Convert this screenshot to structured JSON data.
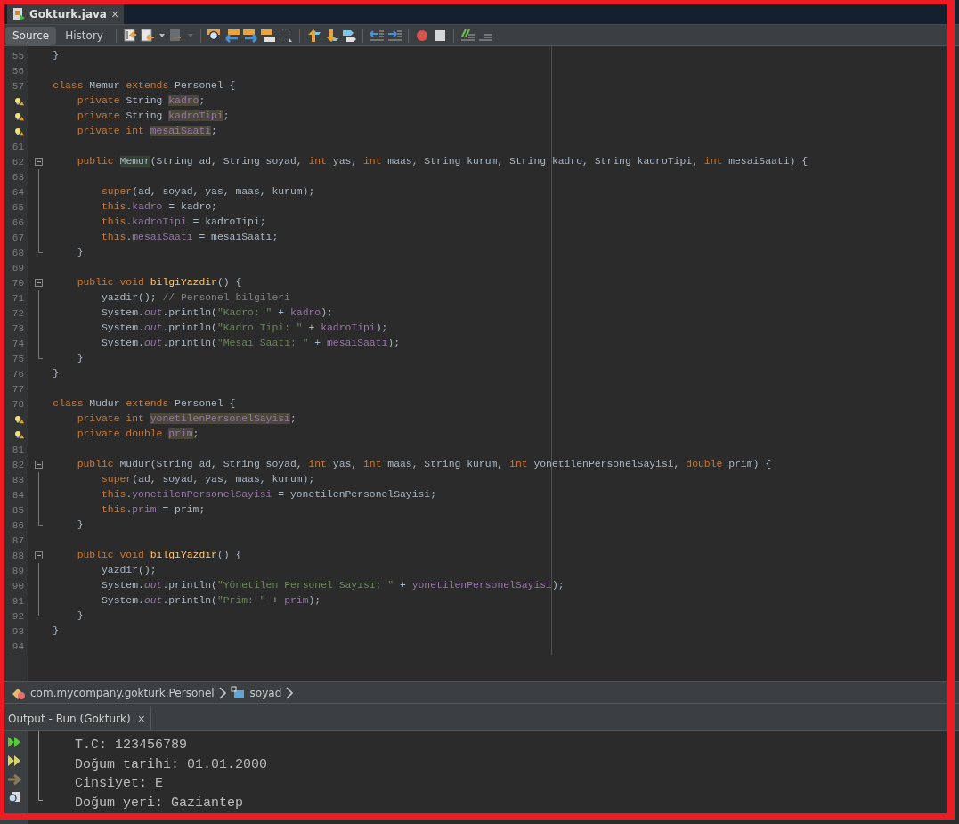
{
  "editor_tab": {
    "title": "Gokturk.java",
    "selected": true,
    "close_label": "×"
  },
  "view_tabs": [
    {
      "label": "Source",
      "selected": true
    },
    {
      "label": "History",
      "selected": false
    }
  ],
  "code": {
    "lines": [
      {
        "number": "55",
        "tokens": [
          {
            "kind": "plain",
            "text": "    }"
          }
        ]
      },
      {
        "number": "56"
      },
      {
        "number": "57",
        "tokens": [
          {
            "kind": "keyword",
            "text": "    class"
          },
          {
            "kind": "plain",
            "text": " Memur "
          },
          {
            "kind": "keyword",
            "text": "extends"
          },
          {
            "kind": "plain",
            "text": " Personel {"
          }
        ]
      },
      {
        "warning": true,
        "tokens": [
          {
            "kind": "keyword",
            "text": "        private"
          },
          {
            "kind": "plain",
            "text": " String "
          },
          {
            "kind": "field",
            "text": "kadro",
            "highlighted": true
          },
          {
            "kind": "plain",
            "text": ";"
          }
        ]
      },
      {
        "warning": true,
        "tokens": [
          {
            "kind": "keyword",
            "text": "        private"
          },
          {
            "kind": "plain",
            "text": " String "
          },
          {
            "kind": "field",
            "text": "kadroTipi",
            "highlighted": true
          },
          {
            "kind": "plain",
            "text": ";"
          }
        ]
      },
      {
        "warning": true,
        "tokens": [
          {
            "kind": "keyword",
            "text": "        private int "
          },
          {
            "kind": "field",
            "text": "mesaiSaati",
            "highlighted": true
          },
          {
            "kind": "plain",
            "text": ";"
          }
        ]
      },
      {
        "number": "61"
      },
      {
        "number": "62",
        "fold_toggle": true,
        "tokens": [
          {
            "kind": "keyword",
            "text": "        public "
          },
          {
            "kind": "plain",
            "text": "Memur",
            "highlighted": true
          },
          {
            "kind": "plain",
            "text": "(String ad, String soyad, "
          },
          {
            "kind": "keyword",
            "text": "int"
          },
          {
            "kind": "plain",
            "text": " yas, "
          },
          {
            "kind": "keyword",
            "text": "int"
          },
          {
            "kind": "plain",
            "text": " maas, String kurum, String kadro, String kadroTipi, "
          },
          {
            "kind": "keyword",
            "text": "int"
          },
          {
            "kind": "plain",
            "text": " mesaiSaati) {"
          }
        ]
      },
      {
        "number": "63",
        "fold_guide": true
      },
      {
        "number": "64",
        "fold_guide": true,
        "tokens": [
          {
            "kind": "keyword",
            "text": "            super"
          },
          {
            "kind": "plain",
            "text": "(ad, soyad, yas, maas, kurum);"
          }
        ]
      },
      {
        "number": "65",
        "fold_guide": true,
        "tokens": [
          {
            "kind": "keyword",
            "text": "            this"
          },
          {
            "kind": "plain",
            "text": "."
          },
          {
            "kind": "field",
            "text": "kadro"
          },
          {
            "kind": "plain",
            "text": " = kadro;"
          }
        ]
      },
      {
        "number": "66",
        "fold_guide": true,
        "tokens": [
          {
            "kind": "keyword",
            "text": "            this"
          },
          {
            "kind": "plain",
            "text": "."
          },
          {
            "kind": "field",
            "text": "kadroTipi"
          },
          {
            "kind": "plain",
            "text": " = kadroTipi;"
          }
        ]
      },
      {
        "number": "67",
        "fold_guide": true,
        "tokens": [
          {
            "kind": "keyword",
            "text": "            this"
          },
          {
            "kind": "plain",
            "text": "."
          },
          {
            "kind": "field",
            "text": "mesaiSaati"
          },
          {
            "kind": "plain",
            "text": " = mesaiSaati;"
          }
        ]
      },
      {
        "number": "68",
        "fold_end": true,
        "tokens": [
          {
            "kind": "plain",
            "text": "        }"
          }
        ]
      },
      {
        "number": "69"
      },
      {
        "number": "70",
        "fold_toggle": true,
        "tokens": [
          {
            "kind": "keyword",
            "text": "        public void "
          },
          {
            "kind": "method",
            "text": "bilgiYazdir"
          },
          {
            "kind": "plain",
            "text": "() {"
          }
        ]
      },
      {
        "number": "71",
        "fold_guide": true,
        "tokens": [
          {
            "kind": "plain",
            "text": "            yazdir(); "
          },
          {
            "kind": "comment",
            "text": "// Personel bilgileri"
          }
        ]
      },
      {
        "number": "72",
        "fold_guide": true,
        "tokens": [
          {
            "kind": "plain",
            "text": "            System."
          },
          {
            "kind": "static",
            "text": "out"
          },
          {
            "kind": "plain",
            "text": ".println("
          },
          {
            "kind": "string",
            "text": "\"Kadro: \""
          },
          {
            "kind": "plain",
            "text": " + "
          },
          {
            "kind": "field",
            "text": "kadro"
          },
          {
            "kind": "plain",
            "text": ");"
          }
        ]
      },
      {
        "number": "73",
        "fold_guide": true,
        "tokens": [
          {
            "kind": "plain",
            "text": "            System."
          },
          {
            "kind": "static",
            "text": "out"
          },
          {
            "kind": "plain",
            "text": ".println("
          },
          {
            "kind": "string",
            "text": "\"Kadro Tipi: \""
          },
          {
            "kind": "plain",
            "text": " + "
          },
          {
            "kind": "field",
            "text": "kadroTipi"
          },
          {
            "kind": "plain",
            "text": ");"
          }
        ]
      },
      {
        "number": "74",
        "fold_guide": true,
        "tokens": [
          {
            "kind": "plain",
            "text": "            System."
          },
          {
            "kind": "static",
            "text": "out"
          },
          {
            "kind": "plain",
            "text": ".println("
          },
          {
            "kind": "string",
            "text": "\"Mesai Saati: \""
          },
          {
            "kind": "plain",
            "text": " + "
          },
          {
            "kind": "field",
            "text": "mesaiSaati"
          },
          {
            "kind": "plain",
            "text": ");"
          }
        ]
      },
      {
        "number": "75",
        "fold_end": true,
        "tokens": [
          {
            "kind": "plain",
            "text": "        }"
          }
        ]
      },
      {
        "number": "76",
        "tokens": [
          {
            "kind": "plain",
            "text": "    }"
          }
        ]
      },
      {
        "number": "77"
      },
      {
        "number": "78",
        "tokens": [
          {
            "kind": "keyword",
            "text": "    class"
          },
          {
            "kind": "plain",
            "text": " Mudur "
          },
          {
            "kind": "keyword",
            "text": "extends"
          },
          {
            "kind": "plain",
            "text": " Personel {"
          }
        ]
      },
      {
        "warning": true,
        "tokens": [
          {
            "kind": "keyword",
            "text": "        private int "
          },
          {
            "kind": "field",
            "text": "yonetilenPersonelSayisi",
            "highlighted": true
          },
          {
            "kind": "plain",
            "text": ";"
          }
        ]
      },
      {
        "warning": true,
        "tokens": [
          {
            "kind": "keyword",
            "text": "        private double "
          },
          {
            "kind": "field",
            "text": "prim",
            "highlighted": true
          },
          {
            "kind": "plain",
            "text": ";"
          }
        ]
      },
      {
        "number": "81"
      },
      {
        "number": "82",
        "fold_toggle": true,
        "tokens": [
          {
            "kind": "keyword",
            "text": "        public"
          },
          {
            "kind": "plain",
            "text": " Mudur(String ad, String soyad, "
          },
          {
            "kind": "keyword",
            "text": "int"
          },
          {
            "kind": "plain",
            "text": " yas, "
          },
          {
            "kind": "keyword",
            "text": "int"
          },
          {
            "kind": "plain",
            "text": " maas, String kurum, "
          },
          {
            "kind": "keyword",
            "text": "int"
          },
          {
            "kind": "plain",
            "text": " yonetilenPersonelSayisi, "
          },
          {
            "kind": "keyword",
            "text": "double"
          },
          {
            "kind": "plain",
            "text": " prim) {"
          }
        ]
      },
      {
        "number": "83",
        "fold_guide": true,
        "tokens": [
          {
            "kind": "keyword",
            "text": "            super"
          },
          {
            "kind": "plain",
            "text": "(ad, soyad, yas, maas, kurum);"
          }
        ]
      },
      {
        "number": "84",
        "fold_guide": true,
        "tokens": [
          {
            "kind": "keyword",
            "text": "            this"
          },
          {
            "kind": "plain",
            "text": "."
          },
          {
            "kind": "field",
            "text": "yonetilenPersonelSayisi"
          },
          {
            "kind": "plain",
            "text": " = yonetilenPersonelSayisi;"
          }
        ]
      },
      {
        "number": "85",
        "fold_guide": true,
        "tokens": [
          {
            "kind": "keyword",
            "text": "            this"
          },
          {
            "kind": "plain",
            "text": "."
          },
          {
            "kind": "field",
            "text": "prim"
          },
          {
            "kind": "plain",
            "text": " = prim;"
          }
        ]
      },
      {
        "number": "86",
        "fold_end": true,
        "tokens": [
          {
            "kind": "plain",
            "text": "        }"
          }
        ]
      },
      {
        "number": "87"
      },
      {
        "number": "88",
        "fold_toggle": true,
        "tokens": [
          {
            "kind": "keyword",
            "text": "        public void "
          },
          {
            "kind": "method",
            "text": "bilgiYazdir"
          },
          {
            "kind": "plain",
            "text": "() {"
          }
        ]
      },
      {
        "number": "89",
        "fold_guide": true,
        "tokens": [
          {
            "kind": "plain",
            "text": "            yazdir();"
          }
        ]
      },
      {
        "number": "90",
        "fold_guide": true,
        "tokens": [
          {
            "kind": "plain",
            "text": "            System."
          },
          {
            "kind": "static",
            "text": "out"
          },
          {
            "kind": "plain",
            "text": ".println("
          },
          {
            "kind": "string",
            "text": "\"Yönetilen Personel Sayısı: \""
          },
          {
            "kind": "plain",
            "text": " + "
          },
          {
            "kind": "field",
            "text": "yonetilenPersonelSayisi"
          },
          {
            "kind": "plain",
            "text": ");"
          }
        ]
      },
      {
        "number": "91",
        "fold_guide": true,
        "tokens": [
          {
            "kind": "plain",
            "text": "            System."
          },
          {
            "kind": "static",
            "text": "out"
          },
          {
            "kind": "plain",
            "text": ".println("
          },
          {
            "kind": "string",
            "text": "\"Prim: \""
          },
          {
            "kind": "plain",
            "text": " + "
          },
          {
            "kind": "field",
            "text": "prim"
          },
          {
            "kind": "plain",
            "text": ");"
          }
        ]
      },
      {
        "number": "92",
        "fold_end": true,
        "tokens": [
          {
            "kind": "plain",
            "text": "        }"
          }
        ]
      },
      {
        "number": "93",
        "tokens": [
          {
            "kind": "plain",
            "text": "    }"
          }
        ]
      },
      {
        "number": "94"
      }
    ]
  },
  "breadcrumb": [
    {
      "kind": "package",
      "label": "com.mycompany.gokturk.Personel"
    },
    {
      "kind": "field",
      "label": "soyad"
    }
  ],
  "output": {
    "title": "Output - Run (Gokturk)",
    "close_label": "×",
    "lines": [
      "T.C: 123456789",
      "Doğum tarihi: 01.01.2000",
      "Cinsiyet: E",
      "Doğum yeri: Gaziantep"
    ]
  }
}
